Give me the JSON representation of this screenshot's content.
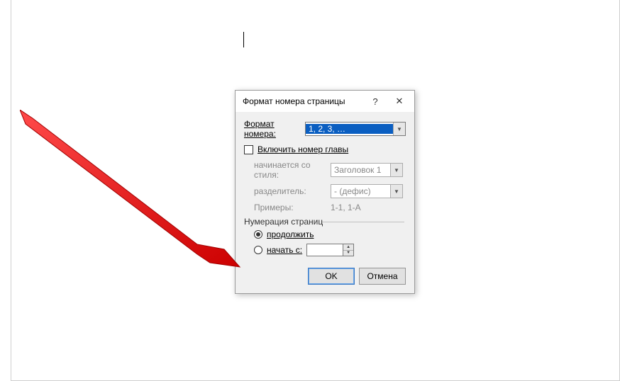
{
  "dialog": {
    "title": "Формат номера страницы",
    "help_icon": "?",
    "close_icon": "✕",
    "format_label": "Формат номера:",
    "format_value": "1, 2, 3, …",
    "include_chapter_label": "Включить номер главы",
    "include_chapter_checked": false,
    "chapter": {
      "starts_with_style_label": "начинается со стиля:",
      "starts_with_style_value": "Заголовок 1",
      "separator_label": "разделитель:",
      "separator_value": "-   (дефис)",
      "examples_label": "Примеры:",
      "examples_value": "1-1, 1-A"
    },
    "numbering": {
      "legend": "Нумерация страниц",
      "continue_label": "продолжить",
      "start_at_label": "начать с:",
      "start_at_value": "",
      "selected": "continue"
    },
    "buttons": {
      "ok": "OK",
      "cancel": "Отмена"
    }
  }
}
